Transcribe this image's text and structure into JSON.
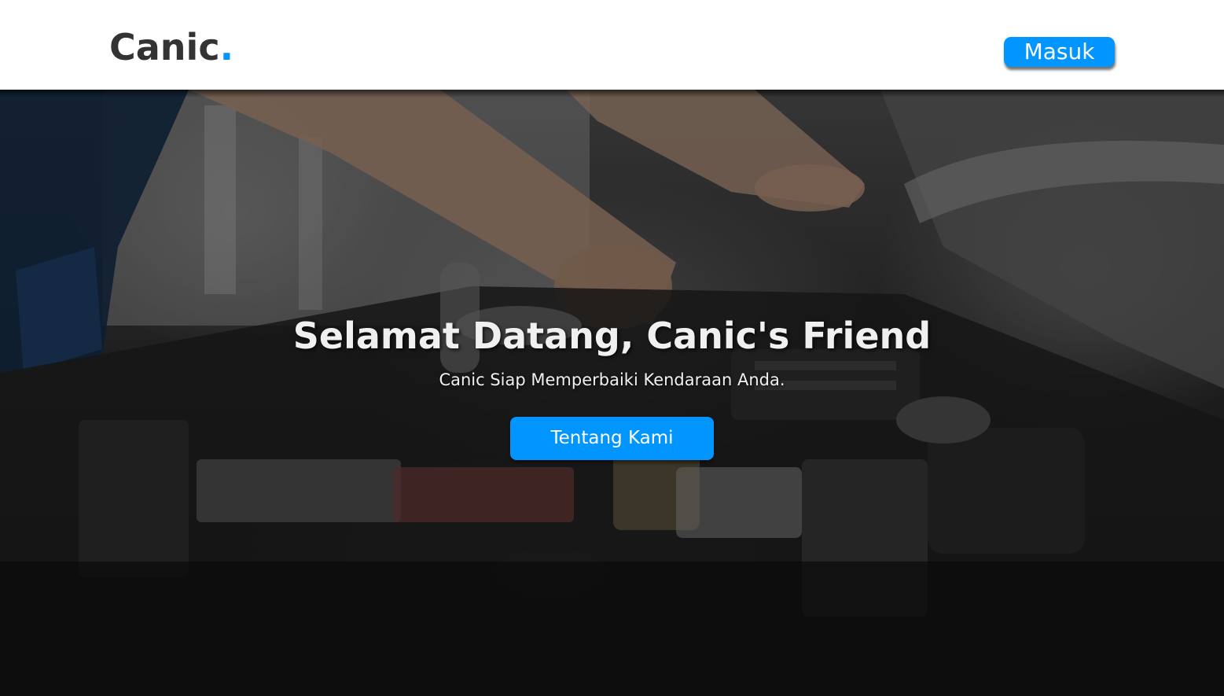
{
  "header": {
    "logo_text": "Canic",
    "logo_dot": ".",
    "login_label": "Masuk"
  },
  "hero": {
    "title": "Selamat Datang, Canic's Friend",
    "subtitle": "Canic Siap Memperbaiki Kendaraan Anda.",
    "cta_label": "Tentang Kami",
    "background_image": "mechanic-engine-photo"
  },
  "colors": {
    "accent": "#0095ff",
    "logo_text": "#333333",
    "hero_text": "#f0f0f0"
  }
}
